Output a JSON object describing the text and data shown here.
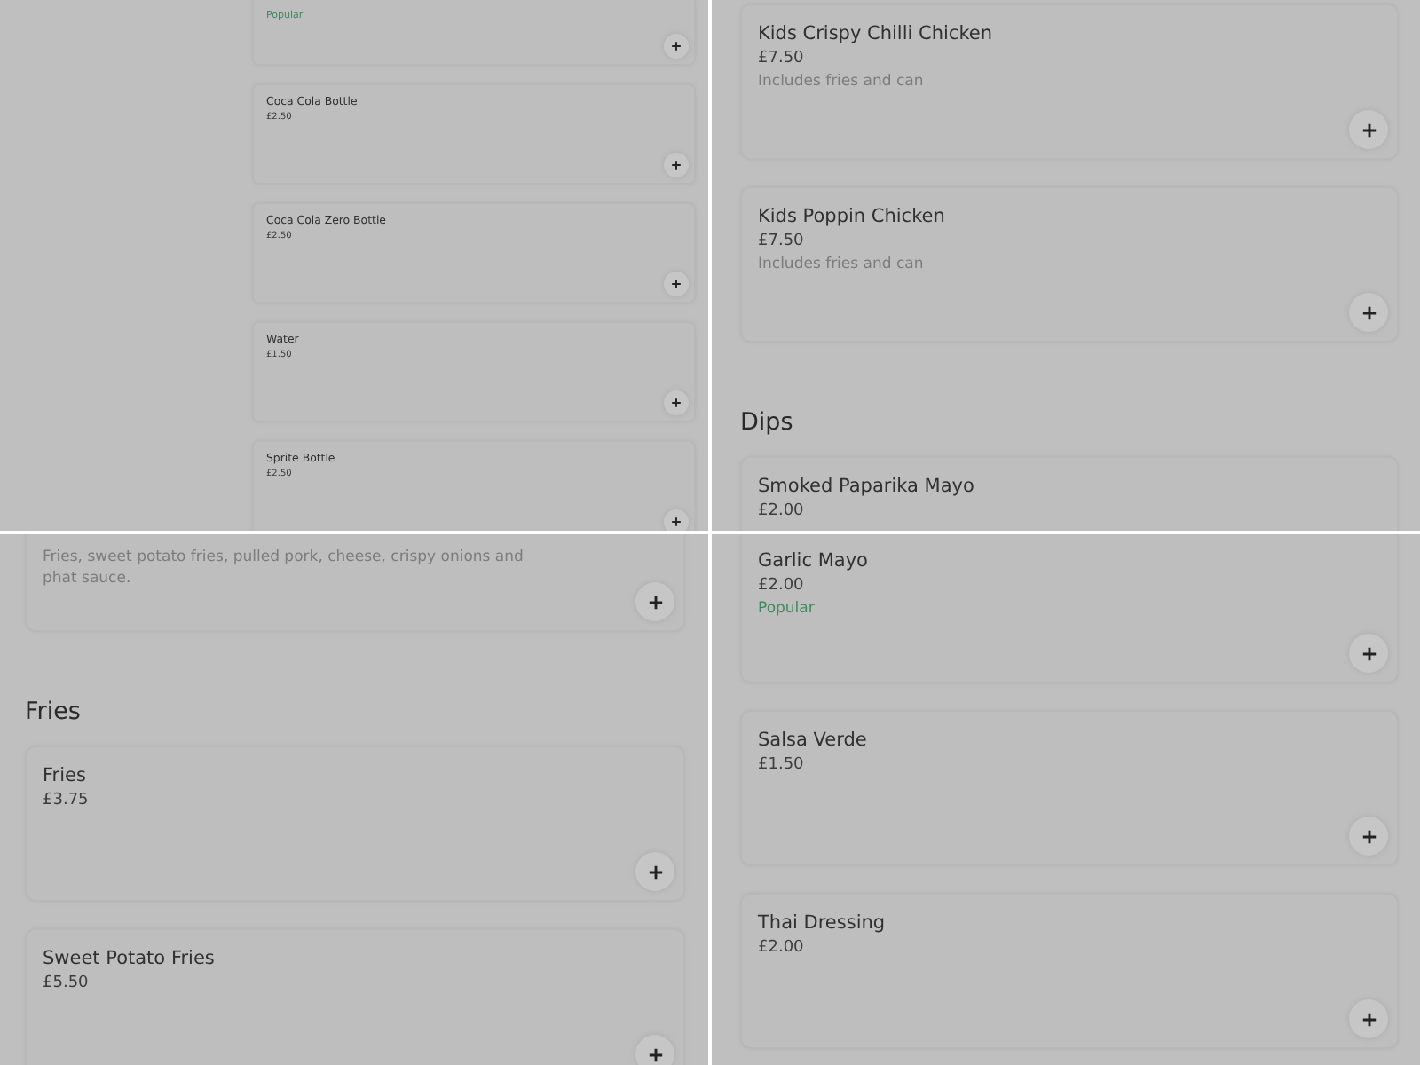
{
  "panels": [
    {
      "blocks": [
        {
          "kind": "card",
          "badge": "Popular"
        },
        {
          "kind": "card",
          "name": "Coca Cola Bottle",
          "price": "£2.50"
        },
        {
          "kind": "card",
          "name": "Coca Cola Zero Bottle",
          "price": "£2.50"
        },
        {
          "kind": "card",
          "name": "Water",
          "price": "£1.50"
        },
        {
          "kind": "card",
          "name": "Sprite Bottle",
          "price": "£2.50"
        }
      ]
    },
    {
      "blocks": [
        {
          "kind": "card",
          "name": "Kids Crispy Chilli Chicken",
          "price": "£7.50",
          "description": "Includes fries and can"
        },
        {
          "kind": "card",
          "name": "Kids Poppin Chicken",
          "price": "£7.50",
          "description": "Includes fries and can"
        },
        {
          "kind": "heading",
          "text": "Dips"
        },
        {
          "kind": "card",
          "name": "Smoked Paparika Mayo",
          "price": "£2.00"
        }
      ]
    },
    {
      "blocks": [
        {
          "kind": "card",
          "description": "Fries, sweet potato fries, pulled pork, cheese, crispy onions and phat sauce."
        },
        {
          "kind": "heading",
          "text": "Fries"
        },
        {
          "kind": "card",
          "name": "Fries",
          "price": "£3.75"
        },
        {
          "kind": "card",
          "name": "Sweet Potato Fries",
          "price": "£5.50"
        }
      ]
    },
    {
      "blocks": [
        {
          "kind": "card",
          "name": "Garlic Mayo",
          "price": "£2.00",
          "badge": "Popular"
        },
        {
          "kind": "card",
          "name": "Salsa Verde",
          "price": "£1.50"
        },
        {
          "kind": "card",
          "name": "Thai Dressing",
          "price": "£2.00"
        }
      ]
    }
  ]
}
